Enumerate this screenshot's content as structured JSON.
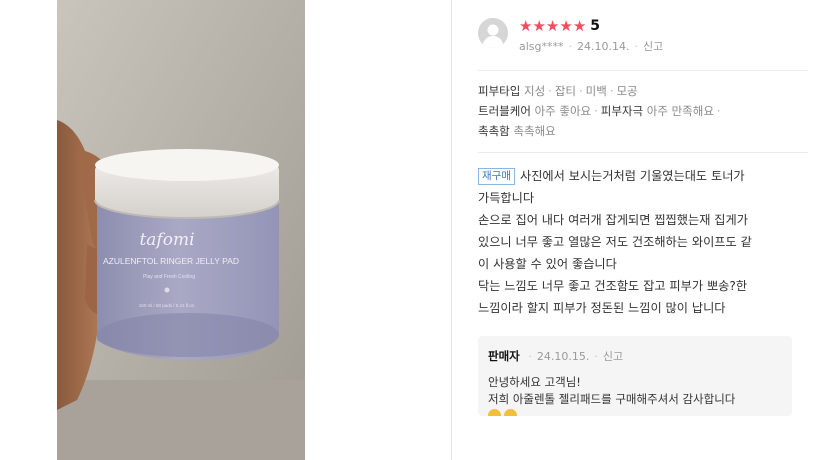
{
  "product_photo": {
    "brand": "tafomi",
    "product_name": "AZULENFTOL RINGER JELLY PAD",
    "tagline": "Play and Fresh Cooling",
    "volume": "160 ml / 80 pads / 5.41 fl.oz."
  },
  "review": {
    "rating_score": "5",
    "stars": 5,
    "star_color": "#f04d5f",
    "username": "alsg****",
    "date": "24.10.14.",
    "report_label": "신고",
    "attributes": [
      {
        "label": "피부타입",
        "values": [
          "지성",
          "잡티",
          "미백",
          "모공"
        ]
      },
      {
        "label": "트러블케어",
        "values": [
          "아주 좋아요"
        ]
      },
      {
        "label": "피부자극",
        "values": [
          "아주 만족해요"
        ]
      },
      {
        "label": "촉촉함",
        "values": [
          "촉촉해요"
        ]
      }
    ],
    "repurchase_badge": "재구매",
    "badge_color": "#3f78bd",
    "body_lines": [
      "사진에서 보시는거처럼 기울였는대도 토너가",
      "가득합니다",
      "손으로 집어 내다 여러개 잡게되면 찝찝했는재 집게가",
      "있으니 너무 좋고 열많은 저도 건조해하는 와이프도 같",
      "이 사용할 수 있어 좋습니다",
      "닥는 느낌도 너무 좋고 건조함도 잡고 피부가 뽀송?한",
      "느낌이라 할지 피부가 정돈된 느낌이 많이 납니다"
    ]
  },
  "seller_reply": {
    "name": "판매자",
    "date": "24.10.15.",
    "report_label": "신고",
    "lines": [
      "안녕하세요 고객님!",
      "저희 아줄렌톨 젤리패드를 구매해주셔서 감사합니다"
    ]
  }
}
